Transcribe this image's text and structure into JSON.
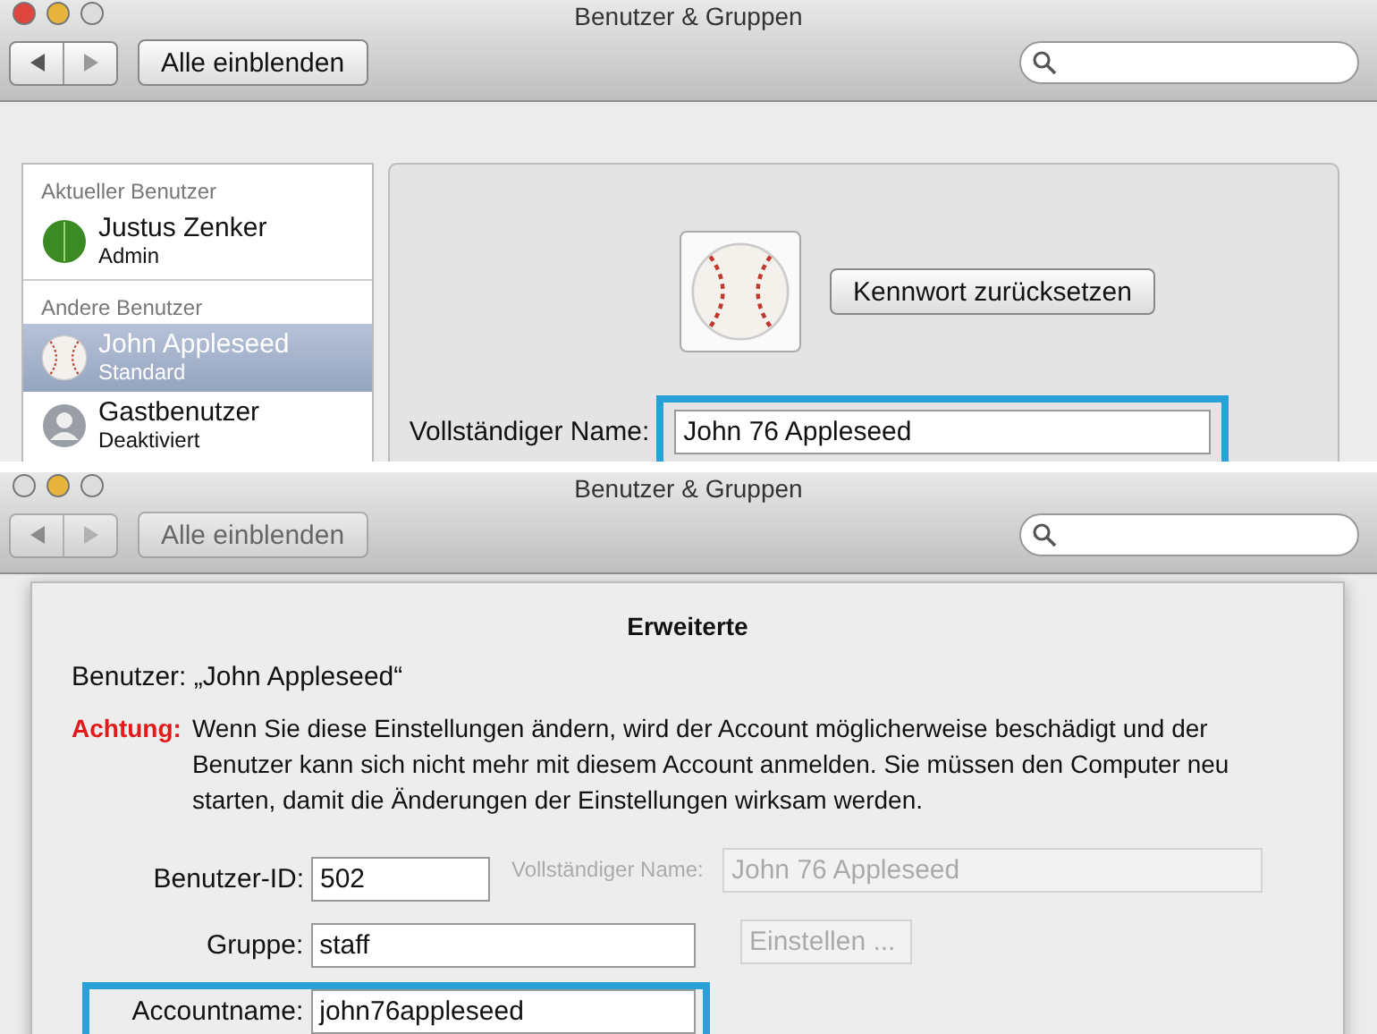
{
  "top_window": {
    "title": "Benutzer & Gruppen",
    "show_all_button": "Alle einblenden",
    "sidebar": [
      {
        "header": "Aktueller Benutzer",
        "users": [
          {
            "name": "Justus Zenker",
            "role": "Admin",
            "kind": "leaf",
            "selected": false
          }
        ]
      },
      {
        "header": "Andere Benutzer",
        "users": [
          {
            "name": "John Appleseed",
            "role": "Standard",
            "kind": "baseball",
            "selected": true
          },
          {
            "name": "Gastbenutzer",
            "role": "Deaktiviert",
            "kind": "guest",
            "selected": false
          }
        ]
      }
    ],
    "detail": {
      "reset_password_button": "Kennwort zurücksetzen",
      "full_name_label": "Vollständiger Name:",
      "full_name_value": "John 76 Appleseed",
      "highlighted": true
    }
  },
  "bottom_window": {
    "title": "Benutzer & Gruppen",
    "show_all_button": "Alle einblenden",
    "background": {
      "full_name_label": "Vollständiger Name:",
      "full_name_value": "John 76 Appleseed",
      "set_button": "Einstellen ..."
    },
    "sheet": {
      "title": "Erweiterte",
      "user_line": "Benutzer: „John Appleseed“",
      "warning_label": "Achtung:",
      "warning_text": "Wenn Sie diese Einstellungen ändern, wird der Account möglicherweise beschädigt und der Benutzer kann sich nicht mehr mit diesem Account anmelden. Sie müssen den Computer neu starten, damit die Änderungen der Einstellungen wirksam werden.",
      "fields": [
        {
          "label": "Benutzer-ID:",
          "value": "502",
          "kind": "short",
          "highlighted": false
        },
        {
          "label": "Gruppe:",
          "value": "staff",
          "kind": "long",
          "highlighted": false
        },
        {
          "label": "Accountname:",
          "value": "john76appleseed",
          "kind": "long",
          "highlighted": true
        }
      ]
    }
  }
}
